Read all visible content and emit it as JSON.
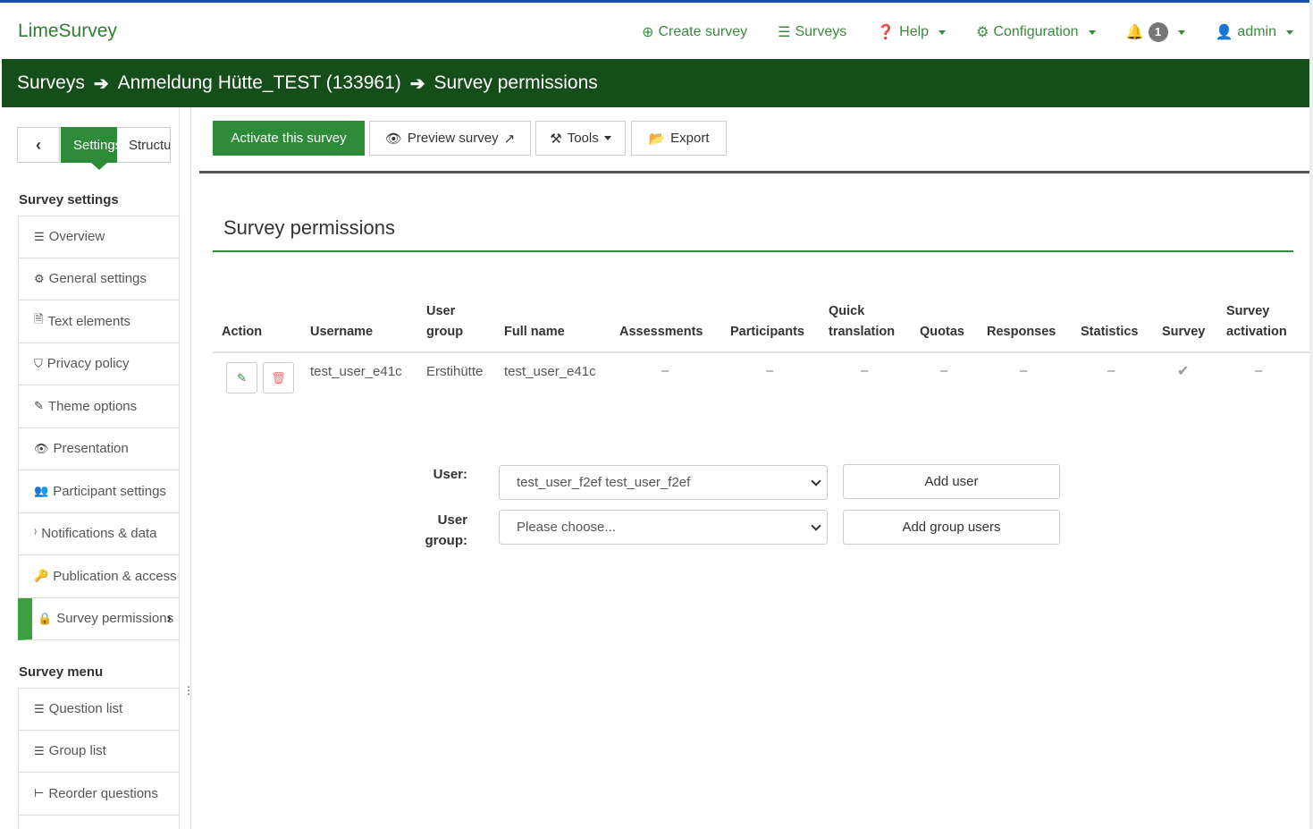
{
  "app": {
    "brand": "LimeSurvey"
  },
  "topnav": {
    "create_survey": "Create survey",
    "surveys": "Surveys",
    "help": "Help",
    "configuration": "Configuration",
    "notifications_count": "1",
    "user": "admin"
  },
  "breadcrumb": {
    "surveys": "Surveys",
    "survey_name": "Anmeldung Hütte_TEST (133961)",
    "current": "Survey permissions"
  },
  "sidebar": {
    "back": "‹",
    "tab_settings": "Settings",
    "tab_structure": "Structure",
    "settings_heading": "Survey settings",
    "settings_items": [
      {
        "label": "Overview",
        "icon": "list-icon"
      },
      {
        "label": "General settings",
        "icon": "gears-icon"
      },
      {
        "label": "Text elements",
        "icon": "file-text-icon"
      },
      {
        "label": "Privacy policy",
        "icon": "shield-icon"
      },
      {
        "label": "Theme options",
        "icon": "brush-icon"
      },
      {
        "label": "Presentation",
        "icon": "eye-slash-icon"
      },
      {
        "label": "Participant settings",
        "icon": "users-icon"
      },
      {
        "label": "Notifications & data",
        "icon": "rss-icon"
      },
      {
        "label": "Publication & access",
        "icon": "key-icon"
      },
      {
        "label": "Survey permissions",
        "icon": "lock-icon"
      }
    ],
    "menu_heading": "Survey menu",
    "menu_items": [
      {
        "label": "Question list",
        "icon": "list-icon"
      },
      {
        "label": "Group list",
        "icon": "list-icon"
      },
      {
        "label": "Reorder questions",
        "icon": "tree-icon"
      }
    ]
  },
  "toolbar": {
    "activate": "Activate this survey",
    "preview": "Preview survey",
    "tools": "Tools",
    "export": "Export"
  },
  "page": {
    "title": "Survey permissions"
  },
  "table": {
    "headers": {
      "action": "Action",
      "username": "Username",
      "user_group": [
        "User",
        "group"
      ],
      "full_name": "Full name",
      "assessments": "Assessments",
      "participants": "Participants",
      "quick_translation": [
        "Quick",
        "translation"
      ],
      "quotas": "Quotas",
      "responses": "Responses",
      "statistics": "Statistics",
      "survey": "Survey",
      "survey_activation": [
        "Survey",
        "activation"
      ]
    },
    "rows": [
      {
        "username": "test_user_e41c",
        "user_group": "Erstihütte",
        "full_name": "test_user_e41c",
        "assessments": "–",
        "participants": "–",
        "quick_translation": "–",
        "quotas": "–",
        "responses": "–",
        "statistics": "–",
        "survey": "✔",
        "survey_activation": "–"
      }
    ]
  },
  "form": {
    "user_label": "User:",
    "user_value": "test_user_f2ef test_user_f2ef",
    "add_user": "Add user",
    "group_label": [
      "User",
      "group:"
    ],
    "group_placeholder": "Please choose...",
    "add_group_users": "Add group users"
  },
  "colors": {
    "accent": "#2e8b3a",
    "breadcrumb_bg": "#154e1b",
    "link": "#3a8a3e"
  }
}
